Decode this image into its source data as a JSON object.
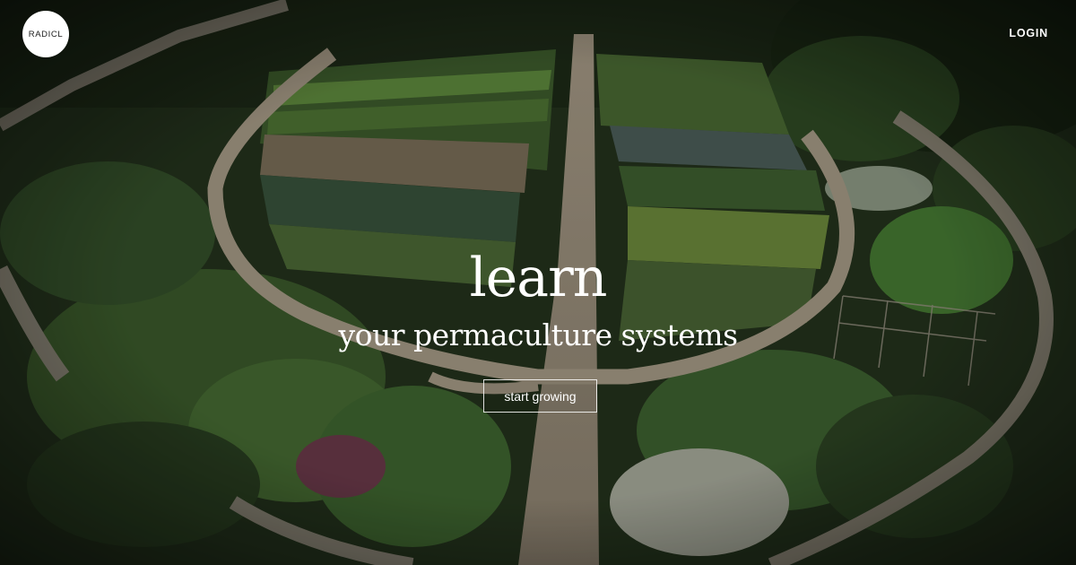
{
  "brand": {
    "logo_text": "RADICL"
  },
  "nav": {
    "login_label": "LOGIN"
  },
  "hero": {
    "headline": "learn",
    "subheadline": "your permaculture systems",
    "cta_label": "start growing",
    "background": "aerial-garden-photo"
  },
  "colors": {
    "text": "#ffffff",
    "logo_bg": "#ffffff",
    "logo_text": "#1c1c1c"
  }
}
